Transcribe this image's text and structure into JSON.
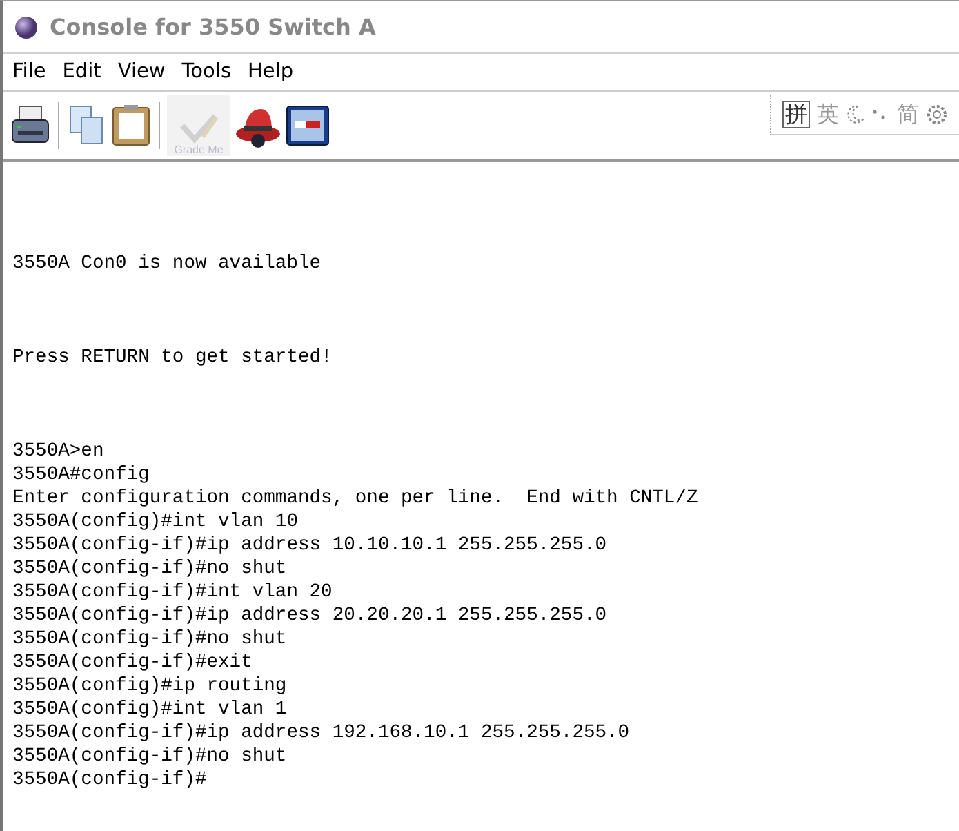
{
  "window": {
    "title": "Console for 3550 Switch A"
  },
  "menu": [
    "File",
    "Edit",
    "View",
    "Tools",
    "Help"
  ],
  "toolbar": [
    {
      "kind": "printer"
    },
    {
      "kind": "separator"
    },
    {
      "kind": "copy"
    },
    {
      "kind": "paste"
    },
    {
      "kind": "separator"
    },
    {
      "kind": "grade",
      "label": "Grade Me",
      "disabled": true
    },
    {
      "kind": "hat"
    },
    {
      "kind": "network"
    }
  ],
  "ime_bar": [
    {
      "kind": "text",
      "text": "拼",
      "selected": true
    },
    {
      "kind": "text",
      "text": "英",
      "selected": false
    },
    {
      "kind": "moon"
    },
    {
      "kind": "dots"
    },
    {
      "kind": "text",
      "text": "简",
      "selected": false
    },
    {
      "kind": "gear"
    }
  ],
  "console": {
    "blocks": [
      [
        "3550A Con0 is now available"
      ],
      [
        "Press RETURN to get started!"
      ],
      [
        "3550A>en",
        "3550A#config",
        "Enter configuration commands, one per line.  End with CNTL/Z",
        "3550A(config)#int vlan 10",
        "3550A(config-if)#ip address 10.10.10.1 255.255.255.0",
        "3550A(config-if)#no shut",
        "3550A(config-if)#int vlan 20",
        "3550A(config-if)#ip address 20.20.20.1 255.255.255.0",
        "3550A(config-if)#no shut",
        "3550A(config-if)#exit",
        "3550A(config)#ip routing",
        "3550A(config)#int vlan 1",
        "3550A(config-if)#ip address 192.168.10.1 255.255.255.0",
        "3550A(config-if)#no shut",
        "3550A(config-if)#"
      ]
    ]
  }
}
